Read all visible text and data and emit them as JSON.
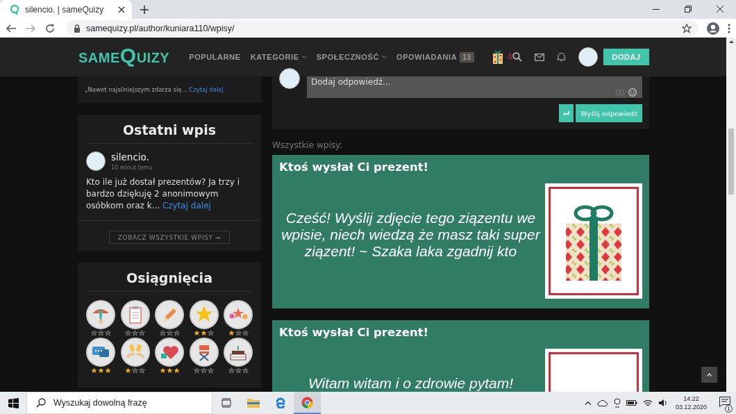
{
  "browser": {
    "tab_title": "silencio. | sameQuizy",
    "url": "samequizy.pl/author/kuniara110/wpisy/"
  },
  "site_nav": {
    "logo": [
      "SAME",
      "Q",
      "UIZY"
    ],
    "menu": [
      {
        "label": "POPULARNE",
        "dropdown": false
      },
      {
        "label": "KATEGORIE",
        "dropdown": true
      },
      {
        "label": "SPOŁECZNOŚĆ",
        "dropdown": true
      },
      {
        "label": "OPOWIADANIA",
        "dropdown": false,
        "count": "13"
      }
    ],
    "gifts_count": "4",
    "add_button": "DODAJ"
  },
  "sidebar": {
    "previous_excerpt": "„Nawet najsilniejszym zdarza się...",
    "previous_link": "Czytaj dalej",
    "latest": {
      "heading": "Ostatni wpis",
      "author": "silencio.",
      "time": "10 minut temu",
      "excerpt": "Kto ile już dostał prezentów? Ja trzy i bardzo dziękuję 2 anonimowym osóbkom oraz k...",
      "link": "Czytaj dalej",
      "all_button": "ZOBACZ WSZYSTKIE WPISY ➞"
    },
    "achievements": {
      "heading": "Osiągnięcia",
      "badges": [
        {
          "kind": "parachute",
          "stars": 0
        },
        {
          "kind": "clipboard",
          "stars": 0
        },
        {
          "kind": "pencil",
          "stars": 0
        },
        {
          "kind": "star",
          "stars": 2
        },
        {
          "kind": "stars",
          "stars": 1
        },
        {
          "kind": "chat",
          "stars": 3
        },
        {
          "kind": "cheers",
          "stars": 1
        },
        {
          "kind": "hearts",
          "stars": 3
        },
        {
          "kind": "chair",
          "stars": 0
        },
        {
          "kind": "cake",
          "stars": 0
        }
      ]
    }
  },
  "main": {
    "reply": {
      "placeholder": "Dodaj odpowiedź...",
      "send_button": "Wyślij odpowiedź"
    },
    "all_posts_label": "Wszystkie wpisy:",
    "posts": [
      {
        "title": "Ktoś wysłał Ci prezent!",
        "body": "Cześć! Wyślij zdjęcie tego ziązentu we wpisie, niech wiedzą że masz taki super ziązent! ~ Szaka laka zgadnij kto",
        "kind": "patterned"
      },
      {
        "title": "Ktoś wysłał Ci prezent!",
        "body": "Witam witam i o zdrowie pytam!",
        "kind": "red"
      }
    ]
  },
  "taskbar": {
    "search_placeholder": "Wyszukaj dowolną frazę",
    "time": "14:22",
    "date": "03.12.2020",
    "notifications": "1"
  }
}
